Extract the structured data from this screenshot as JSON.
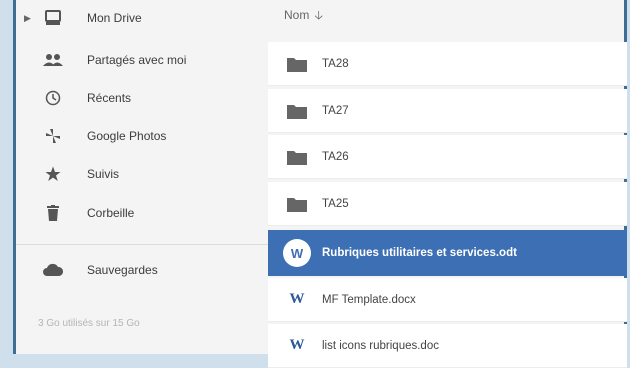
{
  "sidebar": {
    "items": [
      {
        "label": "Mon Drive",
        "icon": "drive-icon"
      },
      {
        "label": "Partagés avec moi",
        "icon": "shared-people-icon"
      },
      {
        "label": "Récents",
        "icon": "clock-icon"
      },
      {
        "label": "Google Photos",
        "icon": "pinwheel-icon"
      },
      {
        "label": "Suivis",
        "icon": "star-icon"
      },
      {
        "label": "Corbeille",
        "icon": "trash-icon"
      },
      {
        "label": "Sauvegardes",
        "icon": "cloud-icon"
      }
    ],
    "storage": "3 Go utilisés sur 15 Go"
  },
  "main": {
    "sort_header": "Nom",
    "files": [
      {
        "name": "TA28",
        "icon": "folder-icon"
      },
      {
        "name": "TA27",
        "icon": "folder-icon"
      },
      {
        "name": "TA26",
        "icon": "folder-icon"
      },
      {
        "name": "TA25",
        "icon": "folder-icon"
      },
      {
        "name": "Rubriques utilitaires et services.odt",
        "icon": "word-icon",
        "selected": true
      },
      {
        "name": "MF Template.docx",
        "icon": "word-icon"
      },
      {
        "name": "list icons rubriques.doc",
        "icon": "word-icon"
      }
    ],
    "word_letter": "W"
  },
  "colors": {
    "selected": "#3d6fb4",
    "border": "#3f6e92"
  }
}
